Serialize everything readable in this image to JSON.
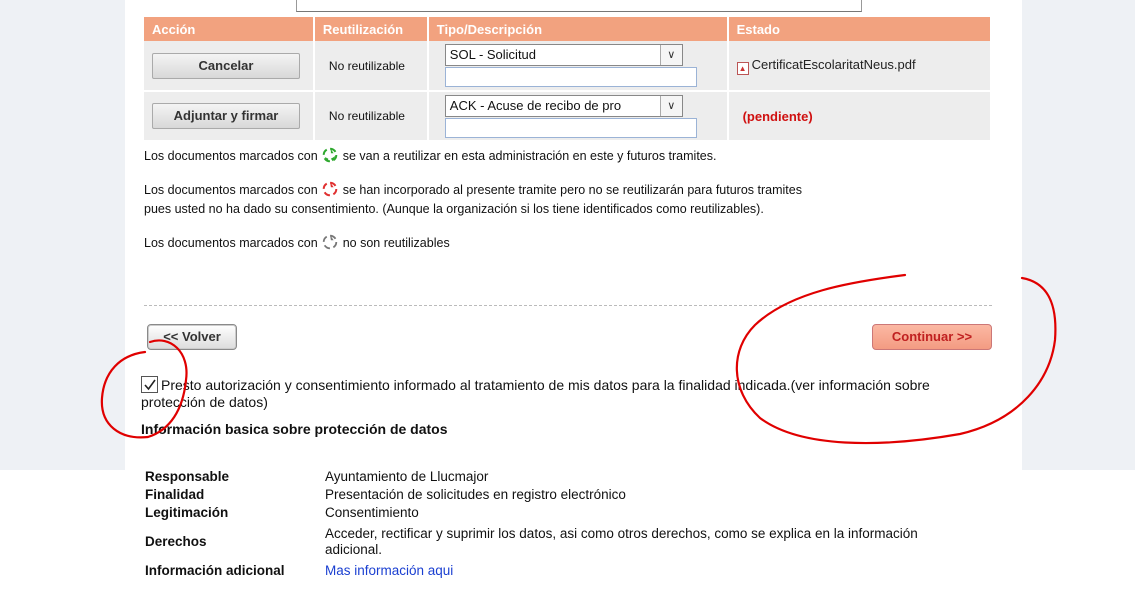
{
  "table": {
    "headers": [
      "Acción",
      "Reutilización",
      "Tipo/Descripción",
      "Estado"
    ],
    "rows": [
      {
        "action": "Cancelar",
        "reuse": "No reutilizable",
        "type": "SOL - Solicitud",
        "status": "CertificatEscolaritatNeus.pdf",
        "status_kind": "file"
      },
      {
        "action": "Adjuntar y firmar",
        "reuse": "No reutilizable",
        "type": "ACK - Acuse de recibo de pro",
        "status": "(pendiente)",
        "status_kind": "pending"
      }
    ]
  },
  "legend": {
    "green_pre": "Los documentos marcados con",
    "green_post": "se van a reutilizar en esta administración en este y futuros tramites.",
    "red_pre": "Los documentos marcados con",
    "red_post": "se han incorporado al presente tramite pero no se reutilizarán para futuros tramites",
    "red_line2": "pues usted no ha dado su consentimiento. (Aunque la organización si los tiene identificados como reutilizables).",
    "grey_pre": "Los documentos marcados con",
    "grey_post": "no son reutilizables"
  },
  "buttons": {
    "back": "<< Volver",
    "continue": "Continuar  >>"
  },
  "consent": {
    "checked": true,
    "text": "Presto autorización y consentimiento informado al tratamiento de mis datos para la finalidad indicada.(ver información sobre protección de datos)"
  },
  "info": {
    "title": "Información basica sobre protección de datos",
    "rows": [
      {
        "key": "Responsable",
        "value": "Ayuntamiento de Llucmajor"
      },
      {
        "key": "Finalidad",
        "value": "Presentación de solicitudes en registro electrónico"
      },
      {
        "key": "Legitimación",
        "value": "Consentimiento"
      },
      {
        "key": "Derechos",
        "value": "Acceder, rectificar y suprimir los datos, asi como otros derechos, como se explica en la información adicional."
      },
      {
        "key": "Información adicional",
        "value": "Mas información aqui"
      }
    ]
  },
  "colors": {
    "header_bg": "#f2a27f",
    "pending": "#d01010",
    "annotation": "#e00000",
    "link": "#1a3fd1"
  },
  "icons": [
    "recycle-green-icon",
    "recycle-red-icon",
    "recycle-grey-icon",
    "pdf-file-icon",
    "checkmark-icon",
    "chevron-down-icon"
  ]
}
